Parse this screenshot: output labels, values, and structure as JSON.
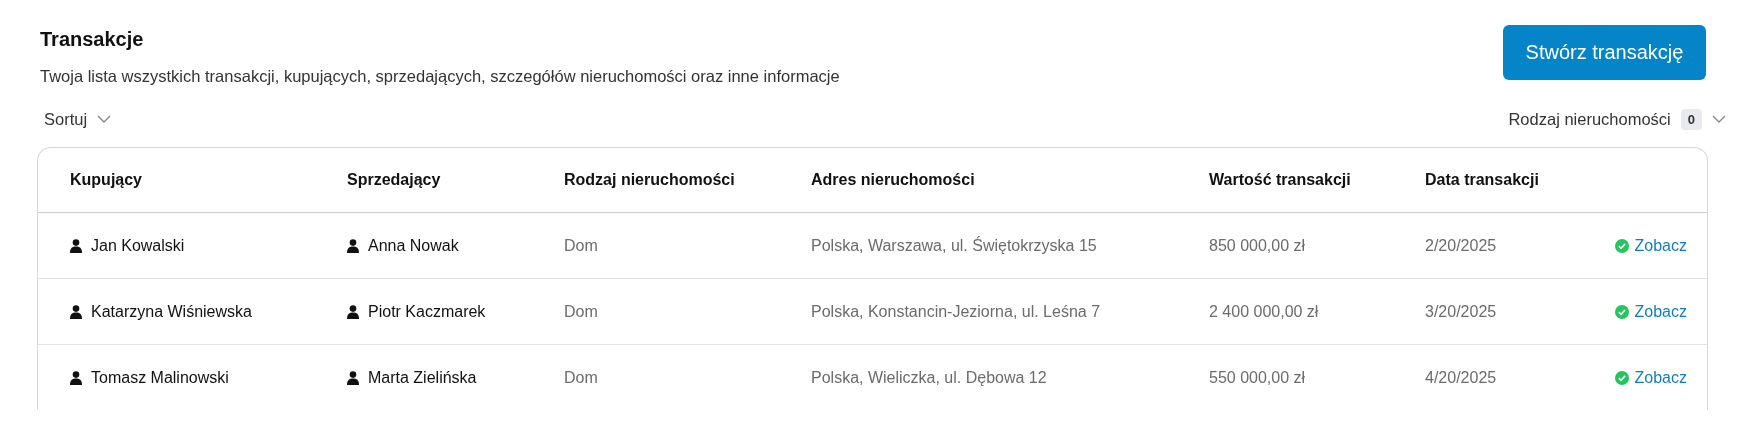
{
  "header": {
    "title": "Transakcje",
    "subtitle": "Twoja lista wszystkich transakcji, kupujących, sprzedających, szczegółów nieruchomości oraz inne informacje",
    "create_button": "Stwórz transakcję"
  },
  "toolbar": {
    "sort": "Sortuj",
    "filter": {
      "label": "Rodzaj nieruchomości",
      "count": "0"
    }
  },
  "table": {
    "columns": [
      "Kupujący",
      "Sprzedający",
      "Rodzaj nieruchomości",
      "Adres nieruchomości",
      "Wartość transakcji",
      "Data transakcji"
    ],
    "rows": [
      {
        "buyer": "Jan Kowalski",
        "seller": "Anna Nowak",
        "type": "Dom",
        "address": "Polska, Warszawa, ul. Świętokrzyska 15",
        "value": "850 000,00 zł",
        "date": "2/20/2025",
        "action": "Zobacz"
      },
      {
        "buyer": "Katarzyna Wiśniewska",
        "seller": "Piotr Kaczmarek",
        "type": "Dom",
        "address": "Polska, Konstancin-Jeziorna, ul. Leśna 7",
        "value": "2 400 000,00 zł",
        "date": "3/20/2025",
        "action": "Zobacz"
      },
      {
        "buyer": "Tomasz Malinowski",
        "seller": "Marta Zielińska",
        "type": "Dom",
        "address": "Polska, Wieliczka, ul. Dębowa 12",
        "value": "550 000,00 zł",
        "date": "4/20/2025",
        "action": "Zobacz"
      }
    ]
  }
}
